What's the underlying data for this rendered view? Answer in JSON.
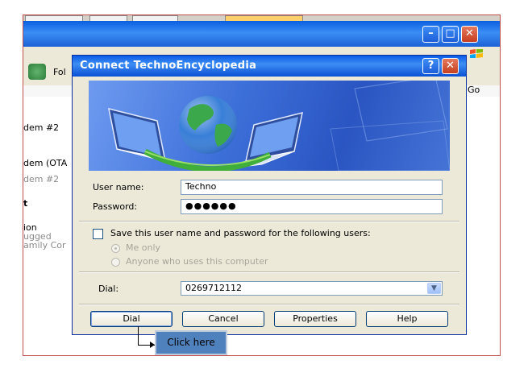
{
  "background_window": {
    "toolbar_folders_label": "Fol",
    "go_label": "Go",
    "list_items": [
      "dem #2",
      "dem (OTA",
      "dem #2",
      "t",
      "ion",
      "ugged",
      "amily Cor"
    ]
  },
  "dialog": {
    "title": "Connect TechnoEncyclopedia",
    "username_label": "User name:",
    "username_value": "Techno",
    "password_label": "Password:",
    "password_value": "●●●●●●",
    "save_checkbox_label": "Save this user name and password for the following users:",
    "radio_me_only": "Me only",
    "radio_anyone": "Anyone who uses this computer",
    "dial_label": "Dial:",
    "dial_value": "0269712112",
    "buttons": {
      "dial": "Dial",
      "cancel": "Cancel",
      "properties": "Properties",
      "help": "Help"
    }
  },
  "annotation": {
    "callout_text": "Click here"
  },
  "colors": {
    "titlebar_blue": "#0a5fe0",
    "dialog_face": "#ece9d8",
    "callout_fill": "#4f81bd",
    "frame_red": "#c0504d"
  }
}
